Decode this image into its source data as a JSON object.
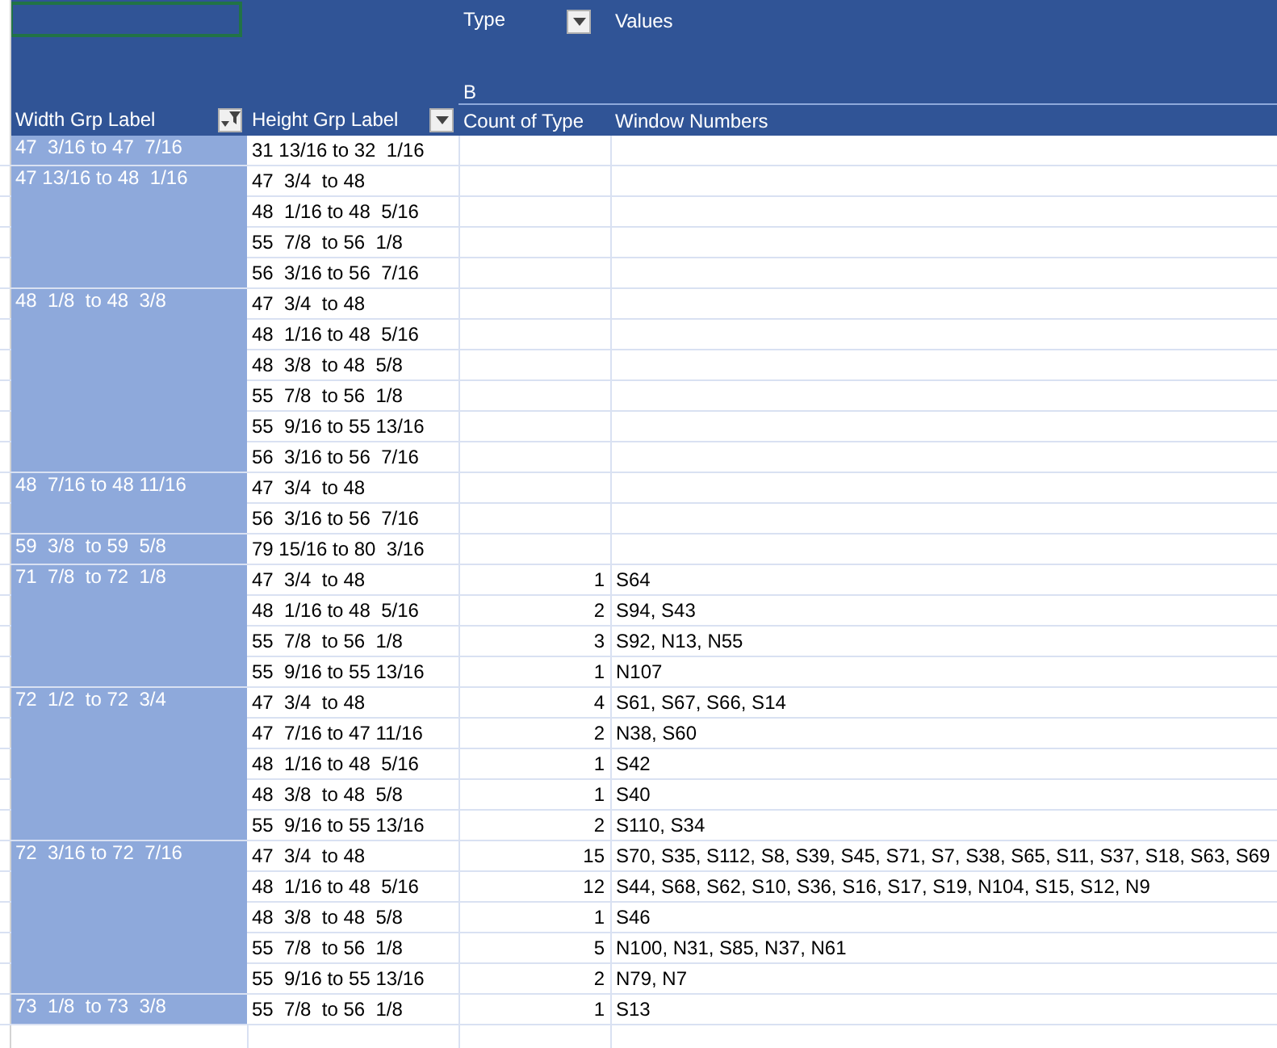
{
  "pivot_header": {
    "column_field": {
      "label": "Type",
      "kind": "dropdown"
    },
    "values_label": "Values",
    "column_item": "B"
  },
  "columns": [
    {
      "label": "Width Grp Label",
      "kind": "filter"
    },
    {
      "label": "Height Grp Label",
      "kind": "dropdown"
    },
    {
      "label": "Count of Type",
      "kind": "plain"
    },
    {
      "label": "Window Numbers",
      "kind": "plain"
    }
  ],
  "groups": [
    {
      "width": "47  3/16 to 47  7/16",
      "rows": [
        {
          "height": "31 13/16 to 32  1/16"
        }
      ]
    },
    {
      "width": "47 13/16 to 48  1/16",
      "rows": [
        {
          "height": "47  3/4  to 48"
        },
        {
          "height": "48  1/16 to 48  5/16"
        },
        {
          "height": "55  7/8  to 56  1/8"
        },
        {
          "height": "56  3/16 to 56  7/16"
        }
      ]
    },
    {
      "width": "48  1/8  to 48  3/8",
      "rows": [
        {
          "height": "47  3/4  to 48"
        },
        {
          "height": "48  1/16 to 48  5/16"
        },
        {
          "height": "48  3/8  to 48  5/8"
        },
        {
          "height": "55  7/8  to 56  1/8"
        },
        {
          "height": "55  9/16 to 55 13/16"
        },
        {
          "height": "56  3/16 to 56  7/16"
        }
      ]
    },
    {
      "width": "48  7/16 to 48 11/16",
      "rows": [
        {
          "height": "47  3/4  to 48"
        },
        {
          "height": "56  3/16 to 56  7/16"
        }
      ]
    },
    {
      "width": "59  3/8  to 59  5/8",
      "rows": [
        {
          "height": "79 15/16 to 80  3/16"
        }
      ]
    },
    {
      "width": "71  7/8  to 72  1/8",
      "rows": [
        {
          "height": "47  3/4  to 48",
          "count": "1",
          "windows": "S64"
        },
        {
          "height": "48  1/16 to 48  5/16",
          "count": "2",
          "windows": "S94, S43"
        },
        {
          "height": "55  7/8  to 56  1/8",
          "count": "3",
          "windows": "S92, N13, N55"
        },
        {
          "height": "55  9/16 to 55 13/16",
          "count": "1",
          "windows": "N107"
        }
      ]
    },
    {
      "width": "72  1/2  to 72  3/4",
      "rows": [
        {
          "height": "47  3/4  to 48",
          "count": "4",
          "windows": "S61, S67, S66, S14"
        },
        {
          "height": "47  7/16 to 47 11/16",
          "count": "2",
          "windows": "N38, S60"
        },
        {
          "height": "48  1/16 to 48  5/16",
          "count": "1",
          "windows": "S42"
        },
        {
          "height": "48  3/8  to 48  5/8",
          "count": "1",
          "windows": "S40"
        },
        {
          "height": "55  9/16 to 55 13/16",
          "count": "2",
          "windows": "S110, S34"
        }
      ]
    },
    {
      "width": "72  3/16 to 72  7/16",
      "rows": [
        {
          "height": "47  3/4  to 48",
          "count": "15",
          "windows": "S70, S35, S112, S8, S39, S45, S71, S7, S38, S65, S11, S37, S18, S63, S69"
        },
        {
          "height": "48  1/16 to 48  5/16",
          "count": "12",
          "windows": "S44, S68, S62, S10, S36, S16, S17, S19, N104, S15, S12, N9"
        },
        {
          "height": "48  3/8  to 48  5/8",
          "count": "1",
          "windows": "S46"
        },
        {
          "height": "55  7/8  to 56  1/8",
          "count": "5",
          "windows": "N100, N31, S85, N37, N61"
        },
        {
          "height": "55  9/16 to 55 13/16",
          "count": "2",
          "windows": "N79, N7"
        }
      ]
    },
    {
      "width": "73  1/8  to 73  3/8",
      "rows": [
        {
          "height": "55  7/8  to 56  1/8",
          "count": "1",
          "windows": "S13"
        }
      ]
    }
  ]
}
